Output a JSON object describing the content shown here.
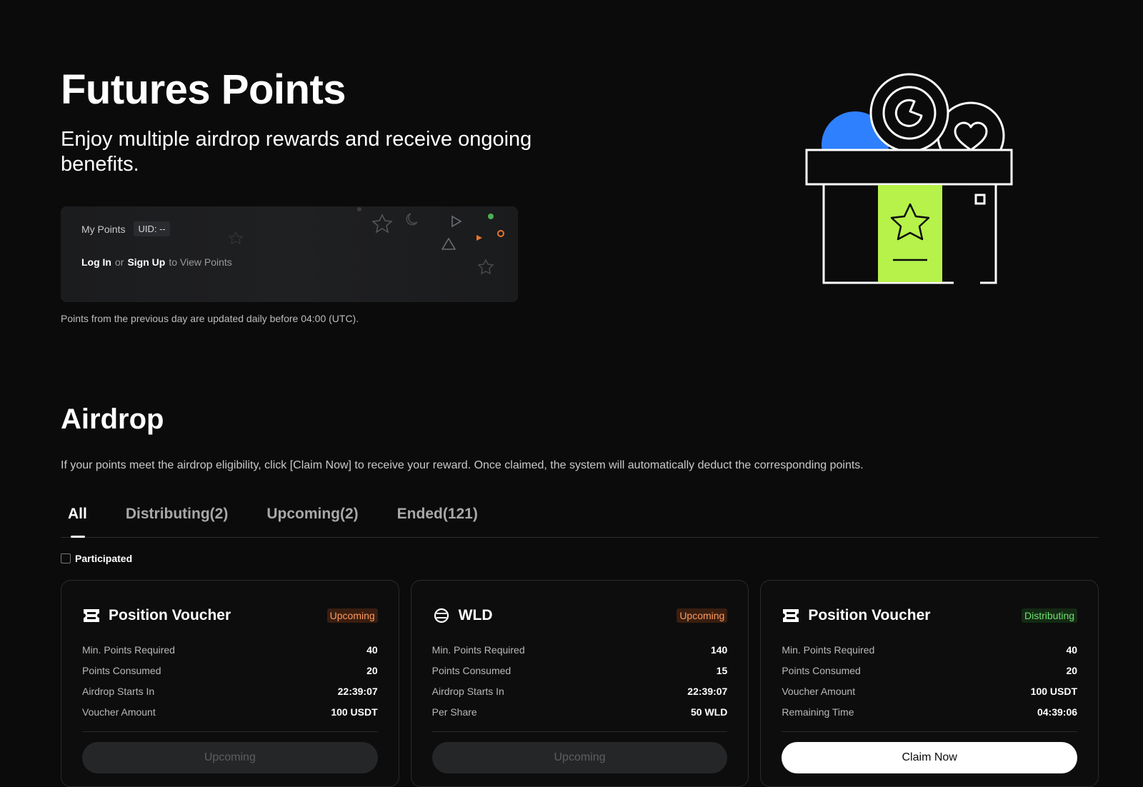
{
  "hero": {
    "title": "Futures Points",
    "subtitle": "Enjoy multiple airdrop rewards and receive ongoing benefits."
  },
  "points_card": {
    "my_points_label": "My Points",
    "uid": "UID: --",
    "login": "Log In",
    "or": "or",
    "signup": "Sign Up",
    "to_view": "to View Points"
  },
  "points_note": "Points from the previous day are updated daily before 04:00 (UTC).",
  "airdrop": {
    "title": "Airdrop",
    "description": "If your points meet the airdrop eligibility, click [Claim Now] to receive your reward. Once claimed, the system will automatically deduct the corresponding points.",
    "tabs": [
      {
        "label": "All",
        "active": true
      },
      {
        "label": "Distributing(2)",
        "active": false
      },
      {
        "label": "Upcoming(2)",
        "active": false
      },
      {
        "label": "Ended(121)",
        "active": false
      }
    ],
    "participated_label": "Participated",
    "cards": [
      {
        "title": "Position Voucher",
        "icon": "ticket-icon",
        "status": "Upcoming",
        "rows": [
          {
            "k": "Min. Points Required",
            "v": "40"
          },
          {
            "k": "Points Consumed",
            "v": "20"
          },
          {
            "k": "Airdrop Starts In",
            "v": "22:39:07"
          },
          {
            "k": "Voucher Amount",
            "v": "100 USDT"
          }
        ],
        "button": "Upcoming"
      },
      {
        "title": "WLD",
        "icon": "worldcoin-icon",
        "status": "Upcoming",
        "rows": [
          {
            "k": "Min. Points Required",
            "v": "140"
          },
          {
            "k": "Points Consumed",
            "v": "15"
          },
          {
            "k": "Airdrop Starts In",
            "v": "22:39:07"
          },
          {
            "k": "Per Share",
            "v": "50 WLD"
          }
        ],
        "button": "Upcoming"
      },
      {
        "title": "Position Voucher",
        "icon": "ticket-icon",
        "status": "Distributing",
        "rows": [
          {
            "k": "Min. Points Required",
            "v": "40"
          },
          {
            "k": "Points Consumed",
            "v": "20"
          },
          {
            "k": "Voucher Amount",
            "v": "100 USDT"
          },
          {
            "k": "Remaining Time",
            "v": "04:39:06"
          }
        ],
        "button": "Claim Now"
      }
    ]
  },
  "colors": {
    "background": "#0b0b0b",
    "accent_green": "#b6f24a",
    "accent_blue": "#2f80ff",
    "upcoming": "#ff9a5c",
    "distributing": "#6ee16e"
  }
}
